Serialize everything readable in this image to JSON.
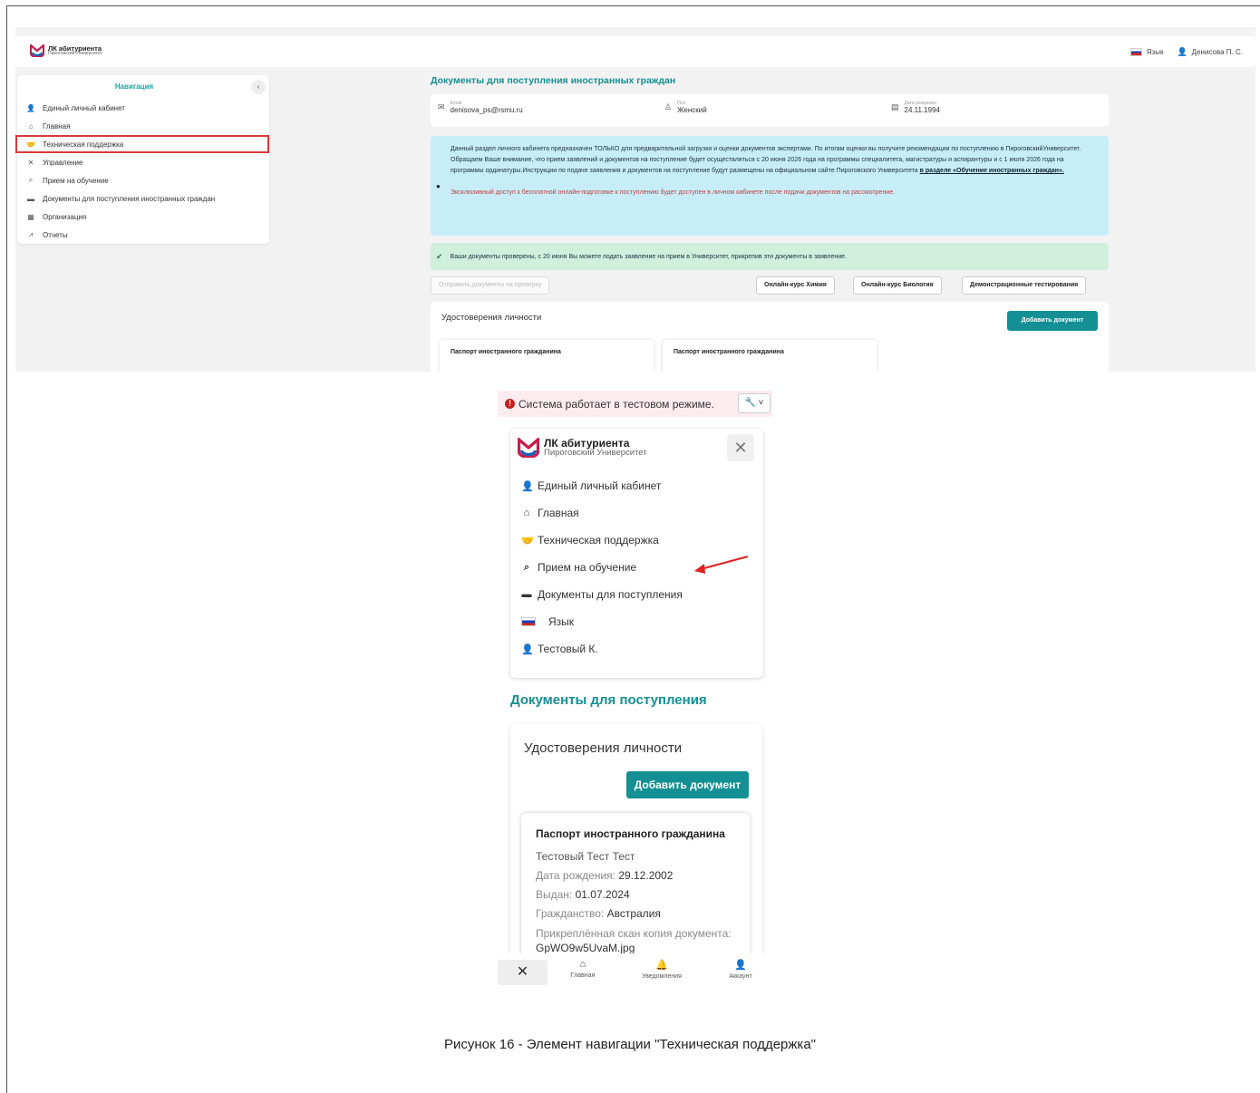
{
  "app": {
    "logo_title": "ЛК абитуриента",
    "logo_subtitle": "Пироговский Университет"
  },
  "desktop": {
    "topbar": {
      "lang_label": "Язык",
      "user_name": "Денисова П. С."
    },
    "nav": {
      "title": "Навигация",
      "items": [
        {
          "label": "Единый личный кабинет",
          "icon": "user-icon",
          "highlighted": false
        },
        {
          "label": "Главная",
          "icon": "home-icon",
          "highlighted": false
        },
        {
          "label": "Техническая поддержка",
          "icon": "handshake-icon",
          "highlighted": true
        },
        {
          "label": "Управление",
          "icon": "tools-icon",
          "highlighted": false
        },
        {
          "label": "Прием на обучение",
          "icon": "search-icon",
          "highlighted": false
        },
        {
          "label": "Документы для поступления иностранных граждан",
          "icon": "folder-icon",
          "highlighted": false
        },
        {
          "label": "Организация",
          "icon": "building-icon",
          "highlighted": false
        },
        {
          "label": "Отчеты",
          "icon": "chart-icon",
          "highlighted": false
        }
      ]
    },
    "main": {
      "title": "Документы для поступления иностранных граждан",
      "email_label": "Email",
      "email_value": "denisova_ps@rsmu.ru",
      "gender_label": "Пол",
      "gender_value": "Женский",
      "birth_label": "Дата рождения",
      "birth_value": "24.11.1994",
      "info_p1": "Данный раздел личного кабинета предназначен ТОЛЬКО для предварительной загрузки и оценки документов экспертами. По итогам оценки вы получите рекомендации по поступлению в ПироговскийУниверситет.",
      "info_p2": "Обращаем Ваше внимание, что прием заявлений и документов на поступление будет осуществляться с 20 июня 2026 года на программы специалитета, магистратуры и аспирантуры и с 1 июля 2026 года на программы ординатуры.Инструкции по подаче заявления и документов на поступление будут размещены на официальном сайте Пироговского Университета",
      "info_link": "в разделе «Обучение иностранных граждан».",
      "info_red": "Эксклюзивный доступ к бесплатной онлайн-подготовке к поступлению будет доступен в личном кабинете после подачи документов на рассмотрение.",
      "success_text": "Ваши документы проверены, с 20 июня Вы можете подать заявление на прием в Университет, прикрепив эти документы в заявление.",
      "btn_send": "Отправить документы на проверку",
      "btn_chem": "Онлайн-курс Химия",
      "btn_bio": "Онлайн-курс Биология",
      "btn_demo": "Демонстрационные тестирования",
      "id_section": "Удостоверения личности",
      "btn_add": "Добавить документ",
      "doc1": "Паспорт иностранного гражданина",
      "doc2": "Паспорт иностранного гражданина"
    }
  },
  "mobile": {
    "test_mode": "Система работает в тестовом режиме.",
    "menu": [
      {
        "label": "Единый личный кабинет",
        "icon": "user-icon"
      },
      {
        "label": "Главная",
        "icon": "home-icon"
      },
      {
        "label": "Техническая поддержка",
        "icon": "handshake-icon"
      },
      {
        "label": "Прием на обучение",
        "icon": "search-icon"
      },
      {
        "label": "Документы для поступления",
        "icon": "folder-icon"
      },
      {
        "label": "Язык",
        "icon": "flag-icon"
      },
      {
        "label": "Тестовый К.",
        "icon": "user-icon"
      }
    ],
    "page_title": "Документы для поступления",
    "id_section": "Удостоверения личности",
    "btn_add": "Добавить документ",
    "doc": {
      "title": "Паспорт иностранного гражданина",
      "name": "Тестовый Тест Тест",
      "birth_label": "Дата рождения:",
      "birth_value": "29.12.2002",
      "issued_label": "Выдан:",
      "issued_value": "01.07.2024",
      "citizenship_label": "Гражданство:",
      "citizenship_value": "Австралия",
      "scan_label": "Прикреплённая скан копия документа:",
      "scan_value": "GpWO9w5UvaM.jpg"
    },
    "bottom_nav": {
      "home": "Главная",
      "notifications": "Уведомления",
      "account": "Аккаунт"
    }
  },
  "caption": "Рисунок 16 - Элемент навигации \"Техническая поддержка\"",
  "colors": {
    "accent": "#149094",
    "highlight": "#d9383a",
    "info_bg": "#c7edf9",
    "success_bg": "#d1efdd",
    "test_bg": "#fdecef"
  }
}
